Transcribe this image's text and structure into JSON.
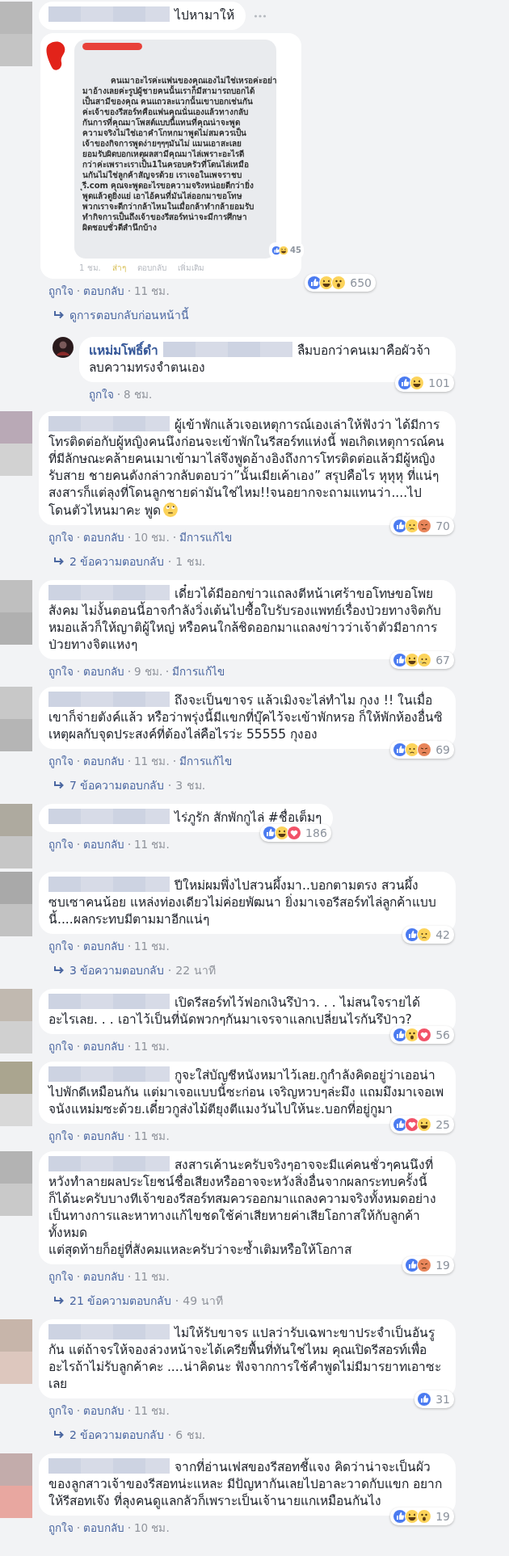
{
  "comments": [
    {
      "name_hidden": true,
      "text": "ไปหามาให้",
      "more_menu": true,
      "attachment": {
        "kind": "screenshot",
        "lines": [
          "คนเมาอะไรค่ะแฟนของคุณเองไม่ใช่เหรอค่ะอย่า",
          "มาอ้างเลยค่ะรูปผู้ชายคนนั้นเราก็มีสามารถบอกได้",
          "เป็นสามีของคุณ คนแถวละแวกนั้นเขาบอกเช่นกัน",
          "ค่ะเจ้าของรีสอร์ทคือแฟนคุณนั่นเองแล้วทางกลับ",
          "กันการที่คุณมาโพสต์แบบนี้แทนที่คุณน่าจะพูด",
          "ความจริงไม่ใช่เอาคำโกหกมาพูดไม่สมควรเป็น",
          "เจ้าของกิจการพูดง่ายๆๆๆมันไม่ แมนเอาสะเลย",
          "ยอมรับผิดบอกเหตุผลสามีคุณมาไล่เพราะอะไรดี",
          "กว่าค่ะเพราะเราเป็น1ในครอบครัวที่โดนไล่เหมือ",
          "นกันไม่ใช่ลูกค้าสัญจรด้วย เราเจอในเพจราชบ",
          "ุรี.com คุณจะพูดอะไรขอความจริงหน่อยดีกว่ายิ่ง",
          "พูดแล้วดูยิ่งแย่ เอาไอ้คนที่มันไล่ออกมาขอโทษ",
          "พวกเราจะดีกว่ากล้าไหมในเมื่อกล้าทำกล้ายอมรับ",
          "ทำกิจการเป็นถึงเจ้าของรีสอร์ทน่าจะมีการศึกษา",
          "ผิดชอบชั่วดีสำนึกบ้าง"
        ],
        "reactions": {
          "icons": [
            {
              "kind": "like"
            },
            {
              "kind": "haha"
            }
          ],
          "count": "45"
        },
        "footer": [
          {
            "label": "1 ชม.",
            "kind": "time"
          },
          {
            "label": "ส่าๆ",
            "kind": "highlight"
          },
          {
            "label": "ตอบกลับ",
            "kind": "time"
          },
          {
            "label": "เพิ่มเติม",
            "kind": "time"
          }
        ]
      },
      "reactions": {
        "icons": [
          {
            "kind": "like"
          },
          {
            "kind": "haha"
          },
          {
            "kind": "wow"
          }
        ],
        "count": "650"
      },
      "actions": [
        {
          "label": "ถูกใจ",
          "kind": "link"
        },
        {
          "label": "ตอบกลับ",
          "kind": "link"
        },
        {
          "label": "11 ชม.",
          "kind": "time"
        }
      ],
      "previous_replies": "ดูการตอบกลับก่อนหน้านี้",
      "replies": [
        {
          "author": "แหม่มโพธิ์ดำ",
          "mention_hidden": true,
          "text": "ลืมบอกว่าคนเมาคือผัวจ้า ลบความทรงจำตนเอง",
          "reactions": {
            "icons": [
              {
                "kind": "like"
              },
              {
                "kind": "haha"
              }
            ],
            "count": "101"
          },
          "actions": [
            {
              "label": "ถูกใจ",
              "kind": "link"
            },
            {
              "label": "8 ชม.",
              "kind": "time"
            }
          ]
        }
      ]
    },
    {
      "name_hidden": true,
      "text": "ผู้เข้าพักแล้วเจอเหตุการณ์เองเล่าให้ฟังว่า ได้มีการโทรติดต่อกับผู้หญิงคนนึงก่อนจะเข้าพักในรีสอร์ทแห่งนี้ พอเกิดเหตุการณ์คนที่มีลักษณะคล้ายคนเมาเข้ามาไล่จึงพูดอ้างอิงถึงการโทรติดต่อแล้วมีผู้หญิงรับสาย ชายคนดังกล่าวกลับตอบว่า”นั้นเมียเค้าเอง” สรุปคือไร หุหุหุ ที่แน่ๆสงสารก็แต่ลุงที่โดนลูกชายด่ามันใช่ไหม!!จนอยากจะถามแทนว่า....ไปโดนตัวไหนมาคะ พูด",
      "emoji": {
        "kind": "eyeroll"
      },
      "reactions": {
        "icons": [
          {
            "kind": "like"
          },
          {
            "kind": "sad"
          },
          {
            "kind": "angry"
          }
        ],
        "count": "70"
      },
      "actions": [
        {
          "label": "ถูกใจ",
          "kind": "link"
        },
        {
          "label": "ตอบกลับ",
          "kind": "link"
        },
        {
          "label": "10 ชม.",
          "kind": "time"
        },
        {
          "label": "มีการแก้ไข",
          "kind": "link"
        }
      ],
      "replies_link": {
        "label": "2 ข้อความตอบกลับ",
        "time": "1 ชม."
      }
    },
    {
      "name_hidden": true,
      "text": "เดี๋ยวได้มีออกข่าวแถลงตีหน้าเศร้าขอโทษขอโพยสังคม ไม่งั้นตอนนี้อาจกำลังวิ่งเต้นไปซื้อใบรับรองแพทย์เรื่องป่วยทางจิตกับหมอแล้วก็ให้ญาติผู้ใหญ่ หรือคนใกล้ชิดออกมาแถลงข่าวว่าเจ้าตัวมีอาการป่วยทางจิตแหงๆ",
      "reactions": {
        "icons": [
          {
            "kind": "like"
          },
          {
            "kind": "haha"
          },
          {
            "kind": "sad"
          }
        ],
        "count": "67"
      },
      "actions": [
        {
          "label": "ถูกใจ",
          "kind": "link"
        },
        {
          "label": "ตอบกลับ",
          "kind": "link"
        },
        {
          "label": "9 ชม.",
          "kind": "time"
        },
        {
          "label": "มีการแก้ไข",
          "kind": "link"
        }
      ]
    },
    {
      "name_hidden": true,
      "text": "ถึงจะเป็นขาจร แล้วเมิงจะไล่ทำไม กุงง !! ในเมื่อเขาก็จ่ายตังค์แล้ว หรือว่าพรุ่งนี้มีแขกที่บุ๊คไว้จะเข้าพักหรอ ก็ให้พักห้องอื่นซิ เหตุผลกับจุดประสงค์ที่ต้องไล่คือไรว่ะ 55555 กุงอง",
      "reactions": {
        "icons": [
          {
            "kind": "like"
          },
          {
            "kind": "sad"
          },
          {
            "kind": "angry"
          }
        ],
        "count": "69"
      },
      "actions": [
        {
          "label": "ถูกใจ",
          "kind": "link"
        },
        {
          "label": "ตอบกลับ",
          "kind": "link"
        },
        {
          "label": "11 ชม.",
          "kind": "time"
        },
        {
          "label": "มีการแก้ไข",
          "kind": "link"
        }
      ],
      "replies_link": {
        "label": "7 ข้อความตอบกลับ",
        "time": "3 ชม."
      }
    },
    {
      "name_hidden": true,
      "text": "ไร่ภูรัก สักพักกูไล่ #ชื่อเต็มๆ",
      "reactions": {
        "icons": [
          {
            "kind": "like"
          },
          {
            "kind": "haha"
          },
          {
            "kind": "love"
          }
        ],
        "count": "186"
      },
      "actions": [
        {
          "label": "ถูกใจ",
          "kind": "link"
        },
        {
          "label": "ตอบกลับ",
          "kind": "link"
        },
        {
          "label": "11 ชม.",
          "kind": "time"
        }
      ]
    },
    {
      "name_hidden": true,
      "text": "ปีใหม่ผมพึ่งไปสวนผึ้งมา..บอกตามตรง สวนผึ้งซบเซาคนน้อย แหล่งท่องเดียวไม่ค่อยพัฒนา ยิ่งมาเจอรีสอร์ทไล่ลูกค้าแบบนี้....ผลกระทบมีตามมาอีกแน่ๆ",
      "reactions": {
        "icons": [
          {
            "kind": "like"
          },
          {
            "kind": "sad"
          }
        ],
        "count": "42"
      },
      "actions": [
        {
          "label": "ถูกใจ",
          "kind": "link"
        },
        {
          "label": "ตอบกลับ",
          "kind": "link"
        },
        {
          "label": "11 ชม.",
          "kind": "time"
        }
      ],
      "replies_link": {
        "label": "3 ข้อความตอบกลับ",
        "time": "22 นาที"
      }
    },
    {
      "name_hidden": true,
      "text": "เปิดรีสอร์ทไว้ฟอกเงินรึป่าว. . . ไม่สนใจรายได้อะไรเลย. . . เอาไว้เป็นที่นัดพวกๆกันมาเจรจาแลกเปลี่ยนไรกันรึป่าว?",
      "reactions": {
        "icons": [
          {
            "kind": "like"
          },
          {
            "kind": "wow"
          },
          {
            "kind": "love"
          }
        ],
        "count": "56"
      },
      "actions": [
        {
          "label": "ถูกใจ",
          "kind": "link"
        },
        {
          "label": "ตอบกลับ",
          "kind": "link"
        },
        {
          "label": "11 ชม.",
          "kind": "time"
        }
      ]
    },
    {
      "name_hidden": true,
      "text": "กูจะใส่บัญชีหนังหมาไว้เลย.กูกำลังคิดอยู่ว่าเออน่าไปพักดีเหมือนกัน แต่มาเจอแบบนี้ซะก่อน เจริญหวบๆล่ะมึง แถมมึงมาเจอเพจนังแหม่มซะด้วย.เดี๋ยวกูส่งไม้ตียุงตีแมงวันไปให้นะ.บอกที่อยู่กูมา",
      "reactions": {
        "icons": [
          {
            "kind": "like"
          },
          {
            "kind": "love"
          },
          {
            "kind": "haha"
          }
        ],
        "count": "25"
      },
      "actions": [
        {
          "label": "ถูกใจ",
          "kind": "link"
        },
        {
          "label": "ตอบกลับ",
          "kind": "link"
        },
        {
          "label": "11 ชม.",
          "kind": "time"
        }
      ]
    },
    {
      "name_hidden": true,
      "text": "สงสารเค้านะครับจริงๆอาจจะมีแค่คนชั่วๆคนนึงที่หวังทำลายผลประโยชน์ชื่อเสียงหรืออาจจะหวังสิ่งอื่นจากผลกระทบครั้งนี้ก็ได้นะครับบางทีเจ้าของรีสอร์ทสมควรออกมาแถลงความจริงทั้งหมดอย่างเป็นทางการและหาทางแก้ไขชดใช้ค่าเสียหายค่าเสียโอกาสให้กับลูกค้าทั้งหมด\nแต่สุดท้ายก็อยู่ที่สังคมแหละครับว่าจะซ้ำเติมหรือให้โอกาส",
      "reactions": {
        "icons": [
          {
            "kind": "like"
          },
          {
            "kind": "angry"
          }
        ],
        "count": "19"
      },
      "actions": [
        {
          "label": "ถูกใจ",
          "kind": "link"
        },
        {
          "label": "ตอบกลับ",
          "kind": "link"
        },
        {
          "label": "11 ชม.",
          "kind": "time"
        }
      ],
      "replies_link": {
        "label": "21 ข้อความตอบกลับ",
        "time": "49 นาที"
      }
    },
    {
      "name_hidden": true,
      "text": "ไม่ให้รับขาจร แปลว่ารับเฉพาะขาประจำเป็นอันรูกัน แต่ถ้าจรให้จองล่วงหน้าจะได้เครียพื้นที่ทันใช่ไหม คุณเปิดรีสอรท์เพื่ออะไรถ้าไม่รับลูกค้าคะ ....น่าคิดนะ ฟังจากการใช้คำพูดไม่มีมารยาทเอาซะเลย",
      "reactions": {
        "icons": [
          {
            "kind": "like"
          }
        ],
        "count": "31"
      },
      "actions": [
        {
          "label": "ถูกใจ",
          "kind": "link"
        },
        {
          "label": "ตอบกลับ",
          "kind": "link"
        },
        {
          "label": "11 ชม.",
          "kind": "time"
        }
      ],
      "replies_link": {
        "label": "2 ข้อความตอบกลับ",
        "time": "6 ชม."
      }
    },
    {
      "name_hidden": true,
      "text": "จากที่อ่านเฟสของรีสอทชี้แจง คิดว่าน่าจะเป็นผัวของลูกสาวเจ้าของรีสอทน่ะแหละ มีปัญหากันเลยไปอาละวาดกับแขก อยากให้รีสอทเจ๊ง ที่ลุงคนดูแลกลัวก็เพราะเป็นเจ้านายแกเหมือนกันไง",
      "reactions": {
        "icons": [
          {
            "kind": "like"
          },
          {
            "kind": "haha"
          },
          {
            "kind": "wow"
          }
        ],
        "count": "19"
      },
      "actions": [
        {
          "label": "ถูกใจ",
          "kind": "link"
        },
        {
          "label": "ตอบกลับ",
          "kind": "link"
        },
        {
          "label": "10 ชม.",
          "kind": "time"
        }
      ]
    }
  ]
}
